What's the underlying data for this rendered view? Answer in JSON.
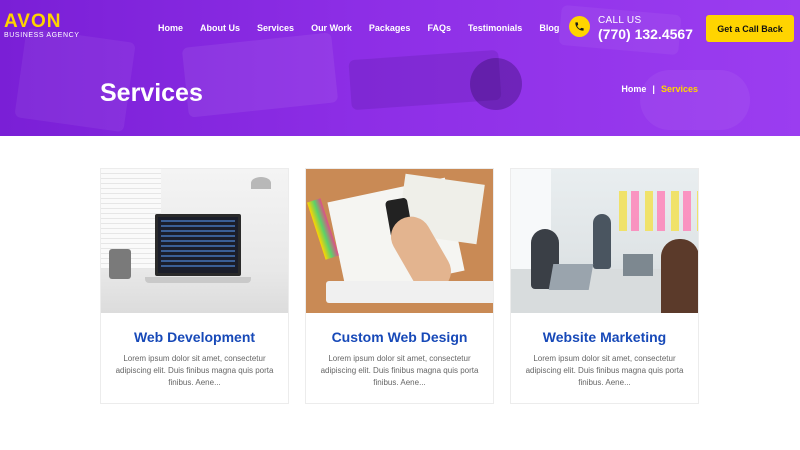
{
  "header": {
    "logo_main": "AVON",
    "logo_sub": "BUSINESS AGENCY",
    "nav": [
      "Home",
      "About Us",
      "Services",
      "Our Work",
      "Packages",
      "FAQs",
      "Testimonials",
      "Blog"
    ],
    "call_label": "CALL US",
    "call_number": "(770) 132.4567",
    "cta_label": "Get a Call Back"
  },
  "banner": {
    "title": "Services",
    "breadcrumb": {
      "home": "Home",
      "separator": "|",
      "current": "Services"
    }
  },
  "services": [
    {
      "title": "Web Development",
      "text": "Lorem ipsum dolor sit amet, consectetur adipiscing elit. Duis finibus magna quis porta finibus. Aene..."
    },
    {
      "title": "Custom Web Design",
      "text": "Lorem ipsum dolor sit amet, consectetur adipiscing elit. Duis finibus magna quis porta finibus. Aene..."
    },
    {
      "title": "Website Marketing",
      "text": "Lorem ipsum dolor sit amet, consectetur adipiscing elit. Duis finibus magna quis porta finibus. Aene..."
    }
  ],
  "colors": {
    "brand_purple": "#8d2ee6",
    "accent_yellow": "#ffd400",
    "title_blue": "#1749b8"
  },
  "icons": {
    "phone": "phone-icon"
  }
}
